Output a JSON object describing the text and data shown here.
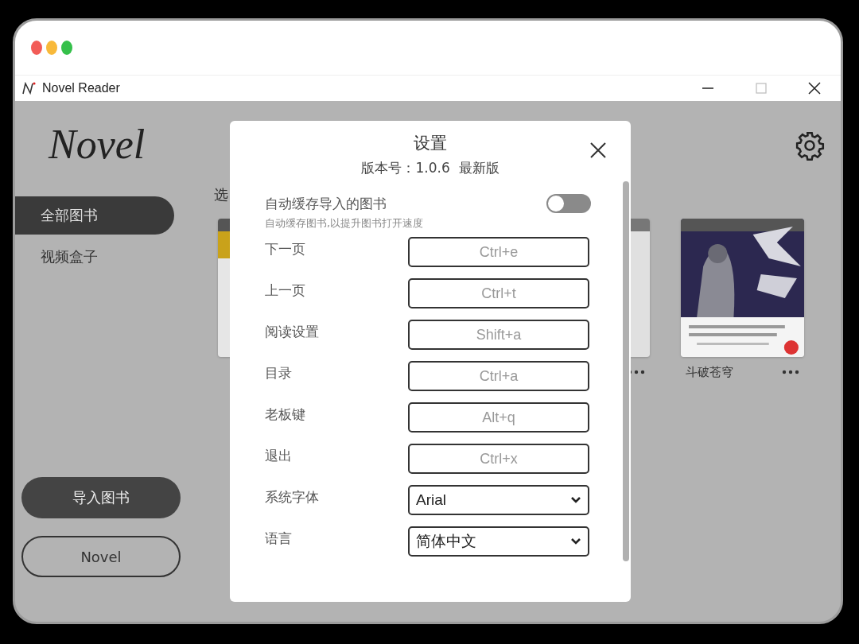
{
  "window": {
    "title": "Novel Reader"
  },
  "sidebar": {
    "logo": "Novel",
    "items": [
      {
        "label": "全部图书",
        "selected": true
      },
      {
        "label": "视频盒子",
        "selected": false
      }
    ],
    "buttons": [
      {
        "label": "导入图书",
        "kind": "filled"
      },
      {
        "label": "Novel",
        "kind": "outline"
      }
    ]
  },
  "main": {
    "heading": "选",
    "books": [
      {
        "kind": "yellow"
      },
      {
        "kind": "grey"
      },
      {
        "kind": "picture",
        "title": "斗破苍穹"
      }
    ]
  },
  "dialog": {
    "title": "设置",
    "version": "版本号：1.0.6  最新版",
    "settings": [
      {
        "kind": "toggle",
        "label": "自动缓存导入的图书",
        "hint": "自动缓存图书,以提升图书打开速度",
        "on": false
      },
      {
        "kind": "shortcut",
        "label": "下一页",
        "value": "Ctrl+e"
      },
      {
        "kind": "shortcut",
        "label": "上一页",
        "value": "Ctrl+t"
      },
      {
        "kind": "shortcut",
        "label": "阅读设置",
        "value": "Shift+a"
      },
      {
        "kind": "shortcut",
        "label": "目录",
        "value": "Ctrl+a"
      },
      {
        "kind": "shortcut",
        "label": "老板键",
        "value": "Alt+q"
      },
      {
        "kind": "shortcut",
        "label": "退出",
        "value": "Ctrl+x"
      },
      {
        "kind": "select",
        "label": "系统字体",
        "value": "Arial"
      },
      {
        "kind": "select",
        "label": "语言",
        "value": "简体中文"
      }
    ]
  }
}
